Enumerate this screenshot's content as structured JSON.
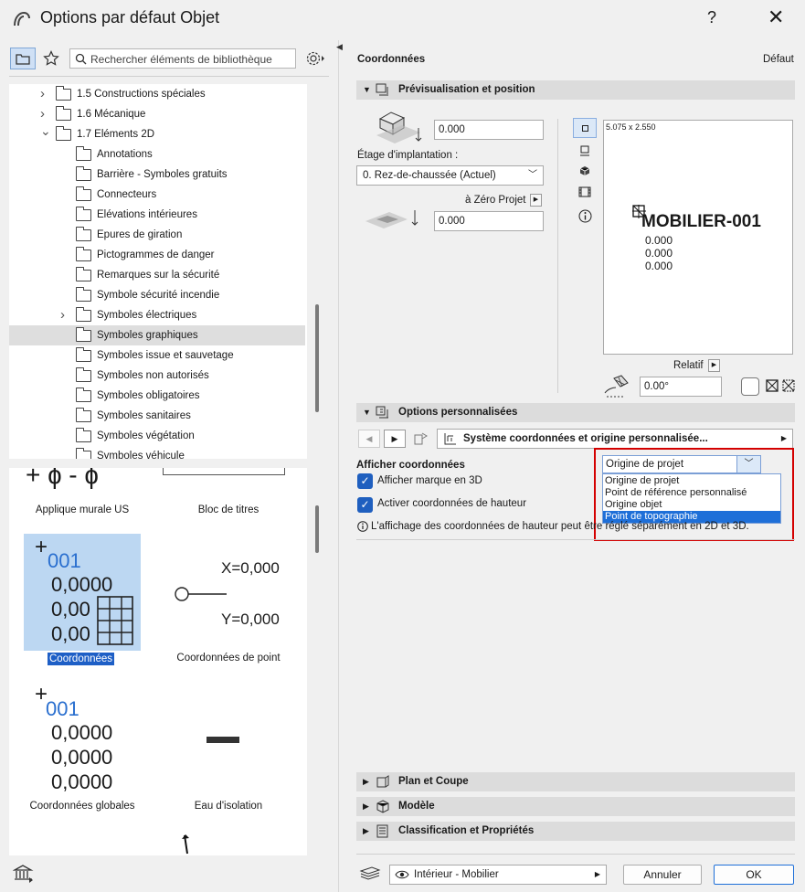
{
  "window": {
    "title": "Options par défaut Objet",
    "help": "?",
    "close": "✕"
  },
  "left": {
    "search_placeholder": "Rechercher éléments de bibliothèque",
    "tree": [
      {
        "label": "1.5 Constructions spéciales",
        "level": 1,
        "expand": "right"
      },
      {
        "label": "1.6 Mécanique",
        "level": 1,
        "expand": "right"
      },
      {
        "label": "1.7 Eléments 2D",
        "level": 1,
        "expand": "down"
      },
      {
        "label": "Annotations",
        "level": 2,
        "expand": ""
      },
      {
        "label": "Barrière - Symboles gratuits",
        "level": 2,
        "expand": ""
      },
      {
        "label": "Connecteurs",
        "level": 2,
        "expand": ""
      },
      {
        "label": "Elévations intérieures",
        "level": 2,
        "expand": ""
      },
      {
        "label": "Epures de giration",
        "level": 2,
        "expand": ""
      },
      {
        "label": "Pictogrammes de danger",
        "level": 2,
        "expand": ""
      },
      {
        "label": "Remarques sur la sécurité",
        "level": 2,
        "expand": ""
      },
      {
        "label": "Symbole sécurité incendie",
        "level": 2,
        "expand": ""
      },
      {
        "label": "Symboles électriques",
        "level": 2,
        "expand": "right"
      },
      {
        "label": "Symboles graphiques",
        "level": 2,
        "expand": "",
        "selected": true
      },
      {
        "label": "Symboles issue et sauvetage",
        "level": 2,
        "expand": ""
      },
      {
        "label": "Symboles non autorisés",
        "level": 2,
        "expand": ""
      },
      {
        "label": "Symboles obligatoires",
        "level": 2,
        "expand": ""
      },
      {
        "label": "Symboles sanitaires",
        "level": 2,
        "expand": ""
      },
      {
        "label": "Symboles végétation",
        "level": 2,
        "expand": ""
      },
      {
        "label": "Symboles véhicule",
        "level": 2,
        "expand": ""
      }
    ],
    "gallery": {
      "item1": "Applique murale US",
      "item2": "Bloc de titres",
      "item3": "Coordonnées",
      "item4": "Coordonnées de point",
      "item5": "Coordonnées globales",
      "item6": "Eau d'isolation",
      "coord_id": "001",
      "coord_v1": "0,0000",
      "coord_v2": "0,00",
      "coord_v3": "0,00",
      "glob_v1": "0,0000",
      "glob_v2": "0,0000",
      "glob_v3": "0,0000",
      "point_x": "X=0,000",
      "point_y": "Y=0,000"
    }
  },
  "right": {
    "header_title": "Coordonnées",
    "header_default": "Défaut",
    "section_preview": "Prévisualisation et position",
    "height_value": "0.000",
    "floor_label": "Étage d'implantation :",
    "floor_value": "0. Rez-de-chaussée (Actuel)",
    "zero_label": "à Zéro Projet",
    "zero_value": "0.000",
    "preview_dims": "5.075 x 2.550",
    "preview_name": "MOBILIER-001",
    "preview_v1": "0.000",
    "preview_v2": "0.000",
    "preview_v3": "0.000",
    "relatif_label": "Relatif",
    "angle_value": "0.00°",
    "section_custom": "Options personnalisées",
    "custom_page": "Système coordonnées et origine personnalisée...",
    "show_coords_label": "Afficher coordonnées",
    "show_coords_value": "Origine de projet",
    "dropdown_options": [
      "Origine de projet",
      "Point de référence personnalisé",
      "Origine objet",
      "Point de topographie"
    ],
    "check1": "Afficher marque en 3D",
    "check2": "Activer coordonnées de hauteur",
    "info_text": "L'affichage des coordonnées de hauteur peut être réglé séparément en 2D et 3D.",
    "section_plan": "Plan et Coupe",
    "section_model": "Modèle",
    "section_class": "Classification et Propriétés",
    "layer_value": "Intérieur - Mobilier",
    "cancel": "Annuler",
    "ok": "OK"
  }
}
